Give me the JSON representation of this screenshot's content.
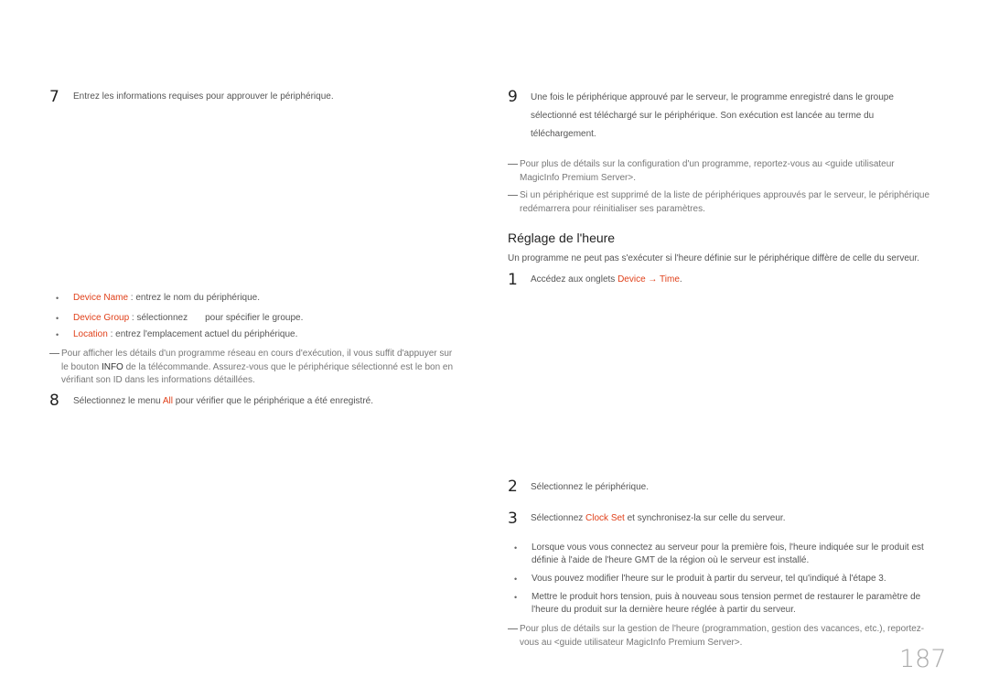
{
  "left": {
    "step7": {
      "number": "7",
      "text": "Entrez les informations requises pour approuver le périphérique."
    },
    "bullets": [
      {
        "term": "Device Name",
        "rest": " : entrez le nom du périphérique."
      },
      {
        "term": "Device Group",
        "rest_a": " : sélectionnez",
        "rest_b": "pour spécifier le groupe."
      },
      {
        "term": "Location",
        "rest": " : entrez l'emplacement actuel du périphérique."
      }
    ],
    "note": {
      "line1": "Pour afficher les détails d'un programme réseau en cours d'exécution, il vous suffit d'appuyer sur",
      "line2_a": "le bouton ",
      "line2_key": "INFO",
      "line2_b": " de la télécommande. Assurez-vous que le périphérique sélectionné est le bon en",
      "line3": "vérifiant son ID dans les informations détaillées."
    },
    "step8": {
      "number": "8",
      "text_a": "Sélectionnez le menu ",
      "term": "All",
      "text_b": " pour vérifier que le périphérique a été enregistré."
    }
  },
  "right": {
    "step9": {
      "number": "9",
      "lines": [
        "Une fois le périphérique approuvé par le serveur, le programme enregistré dans le groupe",
        "sélectionné est téléchargé sur le périphérique. Son exécution est lancée au terme du",
        "téléchargement."
      ]
    },
    "notes_top": [
      {
        "line1": "Pour plus de détails sur la configuration d'un programme, reportez-vous au <guide utilisateur",
        "line2": "MagicInfo Premium Server>."
      },
      {
        "line1": "Si un périphérique est supprimé de la liste de périphériques approuvés par le serveur, le périphérique",
        "line2": "redémarrera pour réinitialiser ses paramètres."
      }
    ],
    "section_title": "Réglage de l'heure",
    "intro": "Un programme ne peut pas s'exécuter si l'heure définie sur le périphérique diffère de celle du serveur.",
    "step1": {
      "number": "1",
      "text_a": "Accédez aux onglets ",
      "term1": "Device",
      "arrow": " → ",
      "term2": "Time",
      "text_b": "."
    },
    "step2": {
      "number": "2",
      "text": "Sélectionnez le périphérique."
    },
    "step3": {
      "number": "3",
      "text_a": "Sélectionnez ",
      "term": "Clock Set",
      "text_b": " et synchronisez-la sur celle du serveur."
    },
    "bullets": [
      {
        "line1": "Lorsque vous vous connectez au serveur pour la première fois, l'heure indiquée sur le produit est",
        "line2": "définie à l'aide de l'heure GMT de la région où le serveur est installé."
      },
      {
        "line1": "Vous pouvez modifier l'heure sur le produit à partir du serveur, tel qu'indiqué à l'étape 3.",
        "line2": ""
      },
      {
        "line1": "Mettre le produit hors tension, puis à nouveau sous tension permet de restaurer le paramètre de",
        "line2": "l'heure du produit sur la dernière heure réglée à partir du serveur."
      }
    ],
    "note_bottom": {
      "line1": "Pour plus de détails sur la gestion de l'heure (programmation, gestion des vacances, etc.), reportez-",
      "line2": "vous au <guide utilisateur MagicInfo Premium Server>."
    }
  },
  "page_number": "187",
  "colors": {
    "accent": "#e0401a",
    "text": "#555555",
    "page_number": "#aaaaaa"
  }
}
